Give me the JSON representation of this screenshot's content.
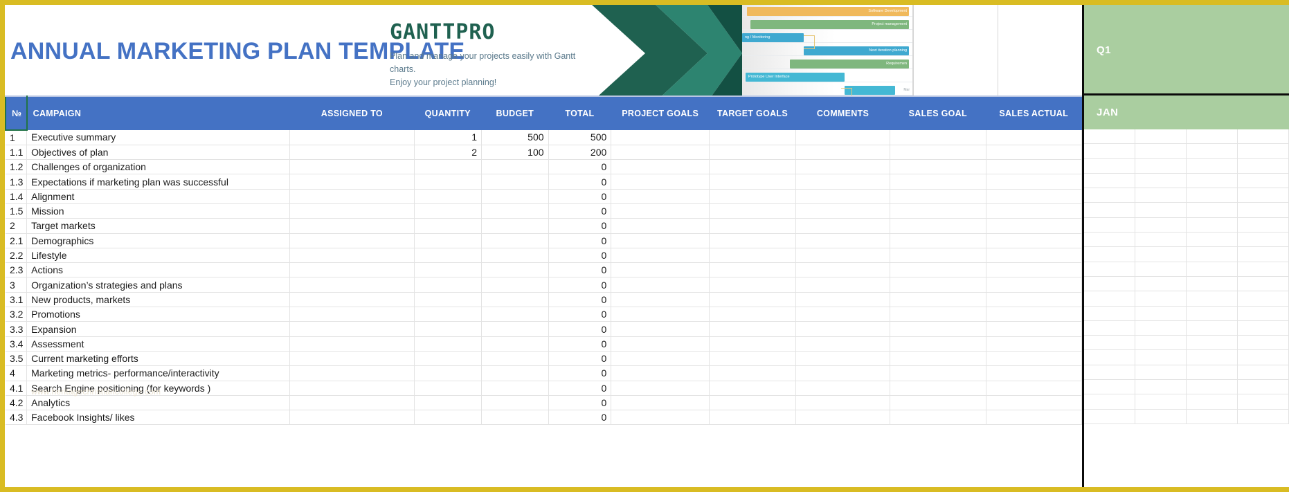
{
  "document": {
    "title": "ANNUAL MARKETING PLAN TEMPLATE",
    "watermark": "www.heritagechristiancollege.com"
  },
  "brand": {
    "logo": "GANTTPRO",
    "tagline_line1": "Plan and manage your projects easily with Gantt charts.",
    "tagline_line2": "Enjoy your project planning!"
  },
  "gantt_preview": {
    "bars": [
      {
        "label": "Software Development",
        "color": "#f0b95c",
        "left_pct": 3,
        "width_pct": 95,
        "align": "right"
      },
      {
        "label": "Project management",
        "color": "#7fb77e",
        "left_pct": 5,
        "width_pct": 93,
        "align": "right"
      },
      {
        "label": "ng / Monitoring",
        "color": "#3fa9d0",
        "left_pct": 0,
        "width_pct": 36,
        "align": "left"
      },
      {
        "label": "Next iteration planning",
        "color": "#3fa9d0",
        "left_pct": 36,
        "width_pct": 62,
        "align": "right"
      },
      {
        "label": "Requiremen",
        "color": "#7fb77e",
        "left_pct": 28,
        "width_pct": 70,
        "align": "right"
      },
      {
        "label": "Prototype User Interface",
        "color": "#44b8d4",
        "left_pct": 2,
        "width_pct": 58,
        "align": "left"
      },
      {
        "label": "",
        "color": "#44b8d4",
        "left_pct": 60,
        "width_pct": 30,
        "align": "left"
      }
    ],
    "month_label": "Mar"
  },
  "quarters": {
    "q1_label": "Q1",
    "jan_label": "JAN"
  },
  "table": {
    "columns": [
      {
        "key": "no",
        "label": "№"
      },
      {
        "key": "campaign",
        "label": "CAMPAIGN"
      },
      {
        "key": "assigned_to",
        "label": "ASSIGNED TO"
      },
      {
        "key": "quantity",
        "label": "QUANTITY"
      },
      {
        "key": "budget",
        "label": "BUDGET"
      },
      {
        "key": "total",
        "label": "TOTAL"
      },
      {
        "key": "project_goals",
        "label": "PROJECT GOALS"
      },
      {
        "key": "target_goals",
        "label": "TARGET GOALS"
      },
      {
        "key": "comments",
        "label": "COMMENTS"
      },
      {
        "key": "sales_goal",
        "label": "SALES GOAL"
      },
      {
        "key": "sales_actual",
        "label": "SALES ACTUAL"
      }
    ],
    "rows": [
      {
        "no": "1",
        "campaign": "Executive summary",
        "assigned_to": "",
        "quantity": "1",
        "budget": "500",
        "total": "500",
        "project_goals": "",
        "target_goals": "",
        "comments": "",
        "sales_goal": "",
        "sales_actual": ""
      },
      {
        "no": "1.1",
        "campaign": "Objectives of plan",
        "assigned_to": "",
        "quantity": "2",
        "budget": "100",
        "total": "200",
        "project_goals": "",
        "target_goals": "",
        "comments": "",
        "sales_goal": "",
        "sales_actual": ""
      },
      {
        "no": "1.2",
        "campaign": "Challenges of organization",
        "assigned_to": "",
        "quantity": "",
        "budget": "",
        "total": "0",
        "project_goals": "",
        "target_goals": "",
        "comments": "",
        "sales_goal": "",
        "sales_actual": ""
      },
      {
        "no": "1.3",
        "campaign": "Expectations if marketing plan was successful",
        "assigned_to": "",
        "quantity": "",
        "budget": "",
        "total": "0",
        "project_goals": "",
        "target_goals": "",
        "comments": "",
        "sales_goal": "",
        "sales_actual": ""
      },
      {
        "no": "1.4",
        "campaign": "Alignment",
        "assigned_to": "",
        "quantity": "",
        "budget": "",
        "total": "0",
        "project_goals": "",
        "target_goals": "",
        "comments": "",
        "sales_goal": "",
        "sales_actual": ""
      },
      {
        "no": "1.5",
        "campaign": "Mission",
        "assigned_to": "",
        "quantity": "",
        "budget": "",
        "total": "0",
        "project_goals": "",
        "target_goals": "",
        "comments": "",
        "sales_goal": "",
        "sales_actual": ""
      },
      {
        "no": "2",
        "campaign": "Target markets",
        "assigned_to": "",
        "quantity": "",
        "budget": "",
        "total": "0",
        "project_goals": "",
        "target_goals": "",
        "comments": "",
        "sales_goal": "",
        "sales_actual": ""
      },
      {
        "no": "2.1",
        "campaign": "Demographics",
        "assigned_to": "",
        "quantity": "",
        "budget": "",
        "total": "0",
        "project_goals": "",
        "target_goals": "",
        "comments": "",
        "sales_goal": "",
        "sales_actual": ""
      },
      {
        "no": "2.2",
        "campaign": "Lifestyle",
        "assigned_to": "",
        "quantity": "",
        "budget": "",
        "total": "0",
        "project_goals": "",
        "target_goals": "",
        "comments": "",
        "sales_goal": "",
        "sales_actual": ""
      },
      {
        "no": "2.3",
        "campaign": "Actions",
        "assigned_to": "",
        "quantity": "",
        "budget": "",
        "total": "0",
        "project_goals": "",
        "target_goals": "",
        "comments": "",
        "sales_goal": "",
        "sales_actual": ""
      },
      {
        "no": "3",
        "campaign": "Organization’s strategies and plans",
        "assigned_to": "",
        "quantity": "",
        "budget": "",
        "total": "0",
        "project_goals": "",
        "target_goals": "",
        "comments": "",
        "sales_goal": "",
        "sales_actual": ""
      },
      {
        "no": "3.1",
        "campaign": "New products, markets",
        "assigned_to": "",
        "quantity": "",
        "budget": "",
        "total": "0",
        "project_goals": "",
        "target_goals": "",
        "comments": "",
        "sales_goal": "",
        "sales_actual": ""
      },
      {
        "no": "3.2",
        "campaign": "Promotions",
        "assigned_to": "",
        "quantity": "",
        "budget": "",
        "total": "0",
        "project_goals": "",
        "target_goals": "",
        "comments": "",
        "sales_goal": "",
        "sales_actual": ""
      },
      {
        "no": "3.3",
        "campaign": "Expansion",
        "assigned_to": "",
        "quantity": "",
        "budget": "",
        "total": "0",
        "project_goals": "",
        "target_goals": "",
        "comments": "",
        "sales_goal": "",
        "sales_actual": ""
      },
      {
        "no": "3.4",
        "campaign": "Assessment",
        "assigned_to": "",
        "quantity": "",
        "budget": "",
        "total": "0",
        "project_goals": "",
        "target_goals": "",
        "comments": "",
        "sales_goal": "",
        "sales_actual": ""
      },
      {
        "no": "3.5",
        "campaign": "Current marketing efforts",
        "assigned_to": "",
        "quantity": "",
        "budget": "",
        "total": "0",
        "project_goals": "",
        "target_goals": "",
        "comments": "",
        "sales_goal": "",
        "sales_actual": ""
      },
      {
        "no": "4",
        "campaign": "Marketing metrics- performance/interactivity",
        "assigned_to": "",
        "quantity": "",
        "budget": "",
        "total": "0",
        "project_goals": "",
        "target_goals": "",
        "comments": "",
        "sales_goal": "",
        "sales_actual": ""
      },
      {
        "no": "4.1",
        "campaign": "Search Engine positioning (for keywords )",
        "assigned_to": "",
        "quantity": "",
        "budget": "",
        "total": "0",
        "project_goals": "",
        "target_goals": "",
        "comments": "",
        "sales_goal": "",
        "sales_actual": ""
      },
      {
        "no": "4.2",
        "campaign": "Analytics",
        "assigned_to": "",
        "quantity": "",
        "budget": "",
        "total": "0",
        "project_goals": "",
        "target_goals": "",
        "comments": "",
        "sales_goal": "",
        "sales_actual": ""
      },
      {
        "no": "4.3",
        "campaign": "Facebook Insights/ likes",
        "assigned_to": "",
        "quantity": "",
        "budget": "",
        "total": "0",
        "project_goals": "",
        "target_goals": "",
        "comments": "",
        "sales_goal": "",
        "sales_actual": ""
      }
    ]
  },
  "colors": {
    "page_border": "#d9bc23",
    "header_blue": "#4472c4",
    "title_blue": "#4472c4",
    "brand_green": "#1f6150",
    "quarter_green": "#aacea0"
  }
}
